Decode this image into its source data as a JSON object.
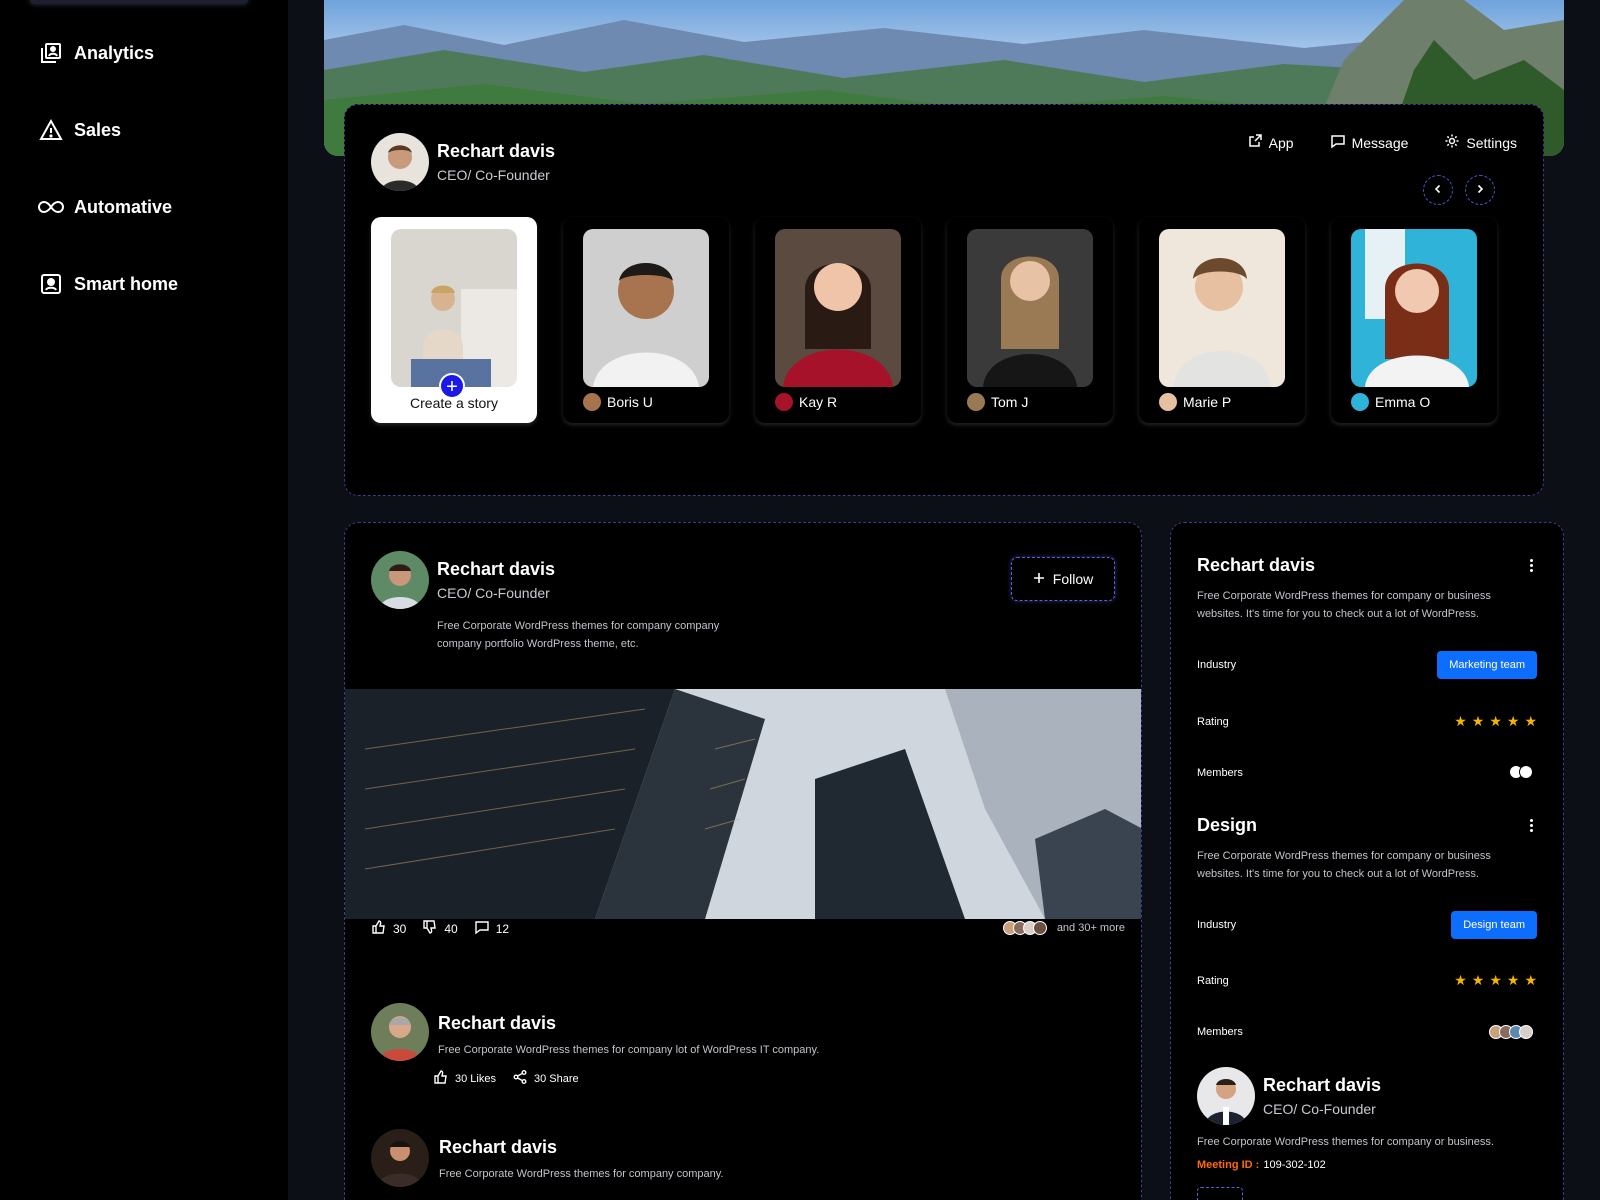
{
  "sidebar": {
    "items": [
      {
        "label": "Analytics",
        "icon": "library-icon"
      },
      {
        "label": "Sales",
        "icon": "warning-icon"
      },
      {
        "label": "Automative",
        "icon": "infinity-icon"
      },
      {
        "label": "Smart home",
        "icon": "portrait-icon"
      }
    ]
  },
  "profile": {
    "name": "Rechart davis",
    "role": "CEO/ Co-Founder",
    "tabs": [
      {
        "label": "App",
        "icon": "external-link-icon"
      },
      {
        "label": "Message",
        "icon": "message-icon"
      },
      {
        "label": "Settings",
        "icon": "gear-icon"
      }
    ],
    "create_story": "Create a story",
    "stories": [
      {
        "name": "Boris U"
      },
      {
        "name": "Kay R"
      },
      {
        "name": "Tom J"
      },
      {
        "name": "Marie P"
      },
      {
        "name": "Emma O"
      }
    ]
  },
  "post": {
    "name": "Rechart davis",
    "role": "CEO/ Co-Founder",
    "text": "Free Corporate WordPress themes for company company company portfolio WordPress theme, etc.",
    "follow_label": "Follow",
    "likes": "30",
    "dislikes": "40",
    "comments": "12",
    "more": "and 30+ more"
  },
  "comments": [
    {
      "name": "Rechart davis",
      "text": "Free Corporate WordPress themes for company lot of WordPress IT company.",
      "likes": "30 Likes",
      "shares": "30 Share"
    },
    {
      "name": "Rechart davis",
      "text": "Free Corporate WordPress themes for company company."
    }
  ],
  "side": {
    "groups": [
      {
        "title": "Rechart davis",
        "desc": "Free Corporate WordPress themes for company or business websites. It's time for you to check out a lot of WordPress.",
        "industry_label": "Industry",
        "industry_value": "Marketing team",
        "rating_label": "Rating",
        "rating": 5,
        "members_label": "Members"
      },
      {
        "title": "Design",
        "desc": "Free Corporate WordPress themes for company or business websites. It's time for you to check out a lot of WordPress.",
        "industry_label": "Industry",
        "industry_value": "Design team",
        "rating_label": "Rating",
        "rating": 5,
        "members_label": "Members"
      }
    ],
    "person": {
      "name": "Rechart davis",
      "role": "CEO/ Co-Founder",
      "desc": "Free Corporate WordPress themes for company or business.",
      "meeting_label": "Meeting ID :",
      "meeting_id": "109-302-102"
    }
  },
  "colors": {
    "accent": "#0d6efd",
    "background": "#0c1016",
    "border": "#3a3f8a",
    "star": "#f6b400",
    "meeting": "#ff6a00"
  }
}
